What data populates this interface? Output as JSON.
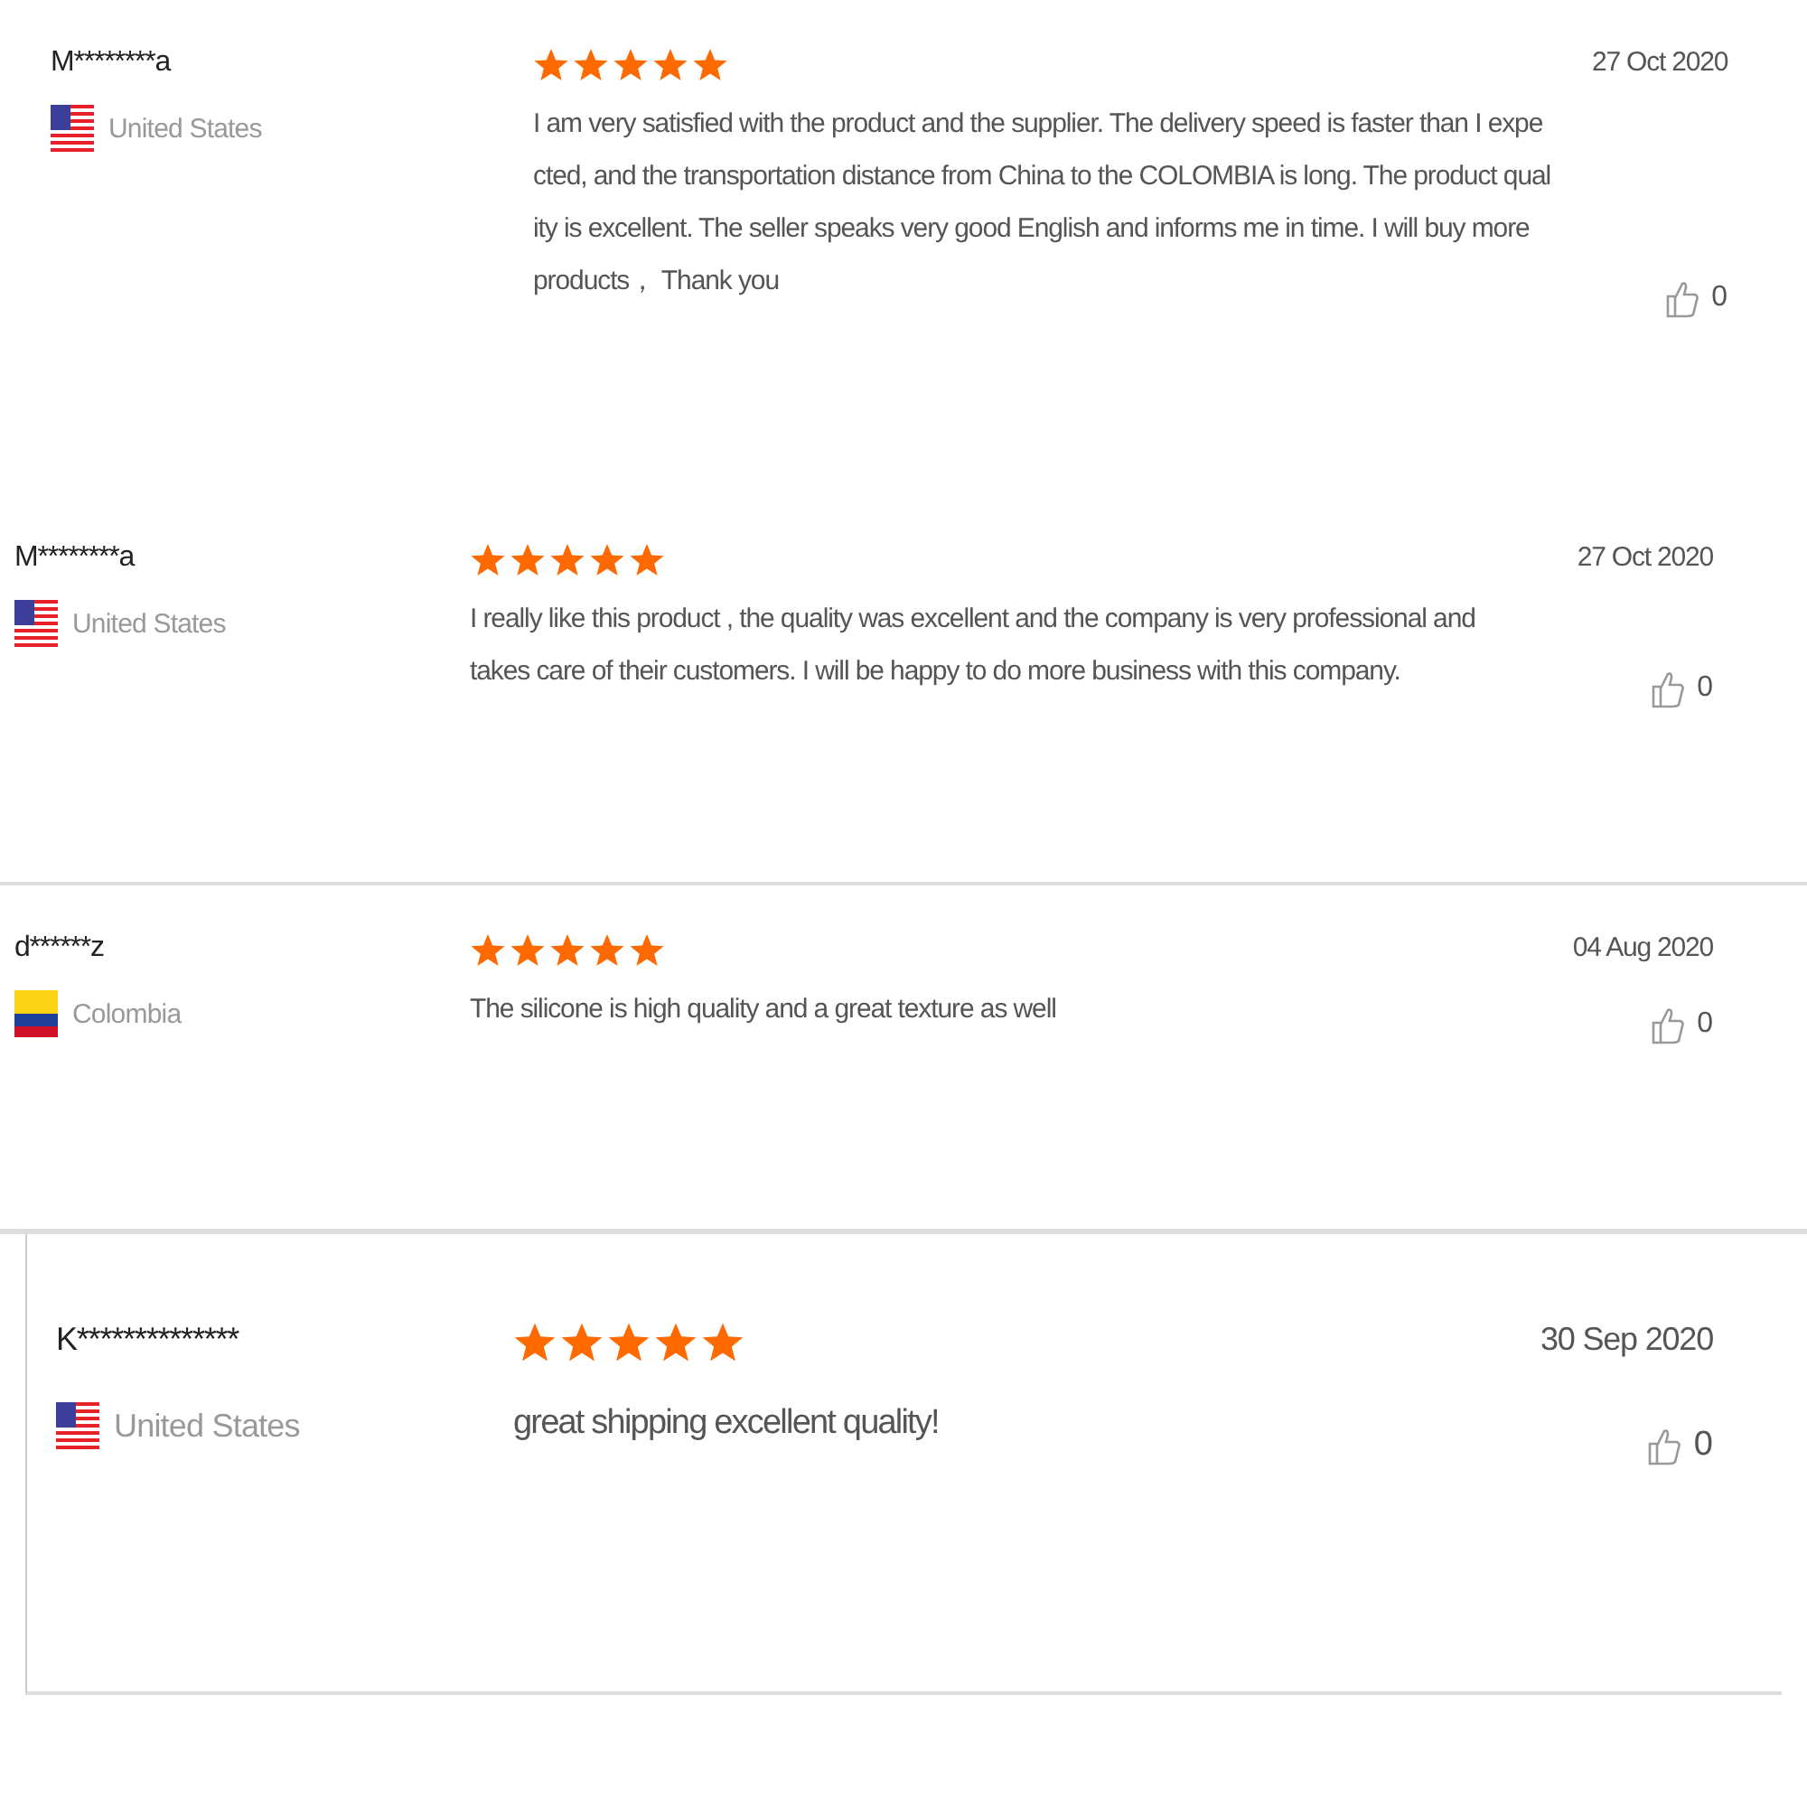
{
  "reviews": [
    {
      "name": "M********a",
      "country": "United States",
      "kind": "us",
      "stars": 5,
      "lines": [
        "I am very satisfied with the product and the supplier. The delivery speed is faster than I expe",
        "cted, and the transportation distance from China to the COLOMBIA is long. The product qual",
        "ity is excellent. The seller speaks very good English and informs me in time. I will buy more",
        "products， Thank you"
      ],
      "date": "27 Oct 2020",
      "likes": "0"
    },
    {
      "name": "M********a",
      "country": "United States",
      "kind": "us",
      "stars": 5,
      "lines": [
        "I really like this product , the quality was excellent and the company is very professional and",
        "takes care of their customers. I will be happy to do more business with this company."
      ],
      "date": "27 Oct 2020",
      "likes": "0"
    },
    {
      "name": "d******z",
      "country": "Colombia",
      "kind": "co",
      "stars": 5,
      "lines": [
        "The silicone is high quality and a great texture as well"
      ],
      "date": "04 Aug 2020",
      "likes": "0"
    },
    {
      "name": "K**************",
      "country": "United States",
      "kind": "us",
      "stars": 5,
      "lines": [
        "great shipping excellent quality!"
      ],
      "date": "30 Sep 2020",
      "likes": "0"
    }
  ]
}
